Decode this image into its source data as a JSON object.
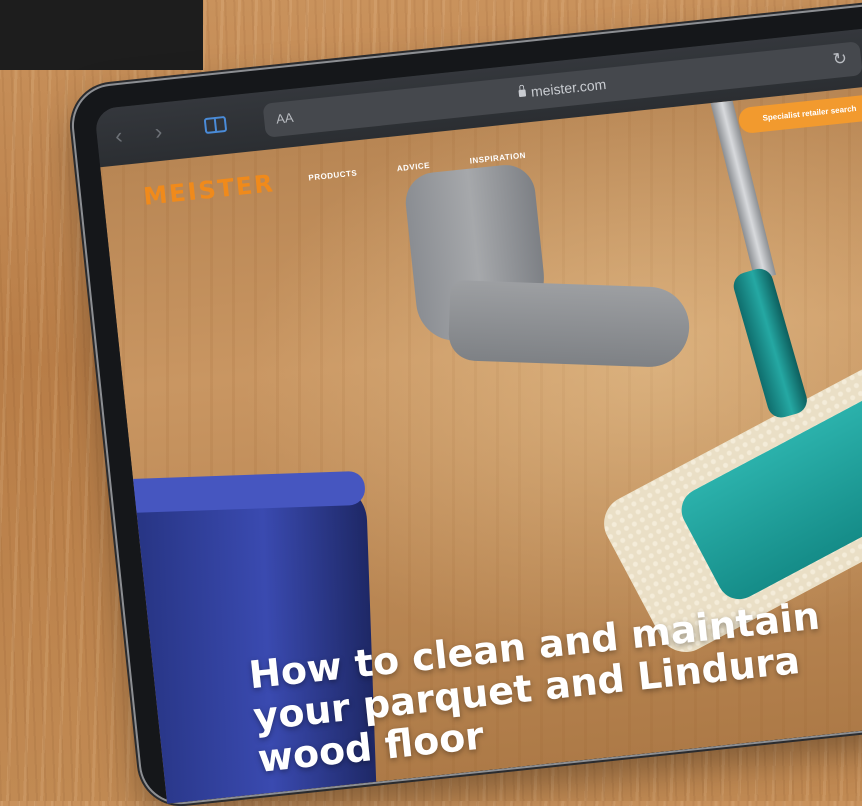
{
  "browser": {
    "url": "meister.com",
    "text_size_label": "AA"
  },
  "site": {
    "logo_text": "MEISTER",
    "nav": [
      "PRODUCTS",
      "ADVICE",
      "INSPIRATION"
    ],
    "dealer_button_label": "Specialist retailer search",
    "accent_color": "#f08a1b"
  },
  "hero": {
    "title_lines": [
      "How to clean and maintain",
      "your parquet and Lindura",
      "wood floor"
    ]
  }
}
